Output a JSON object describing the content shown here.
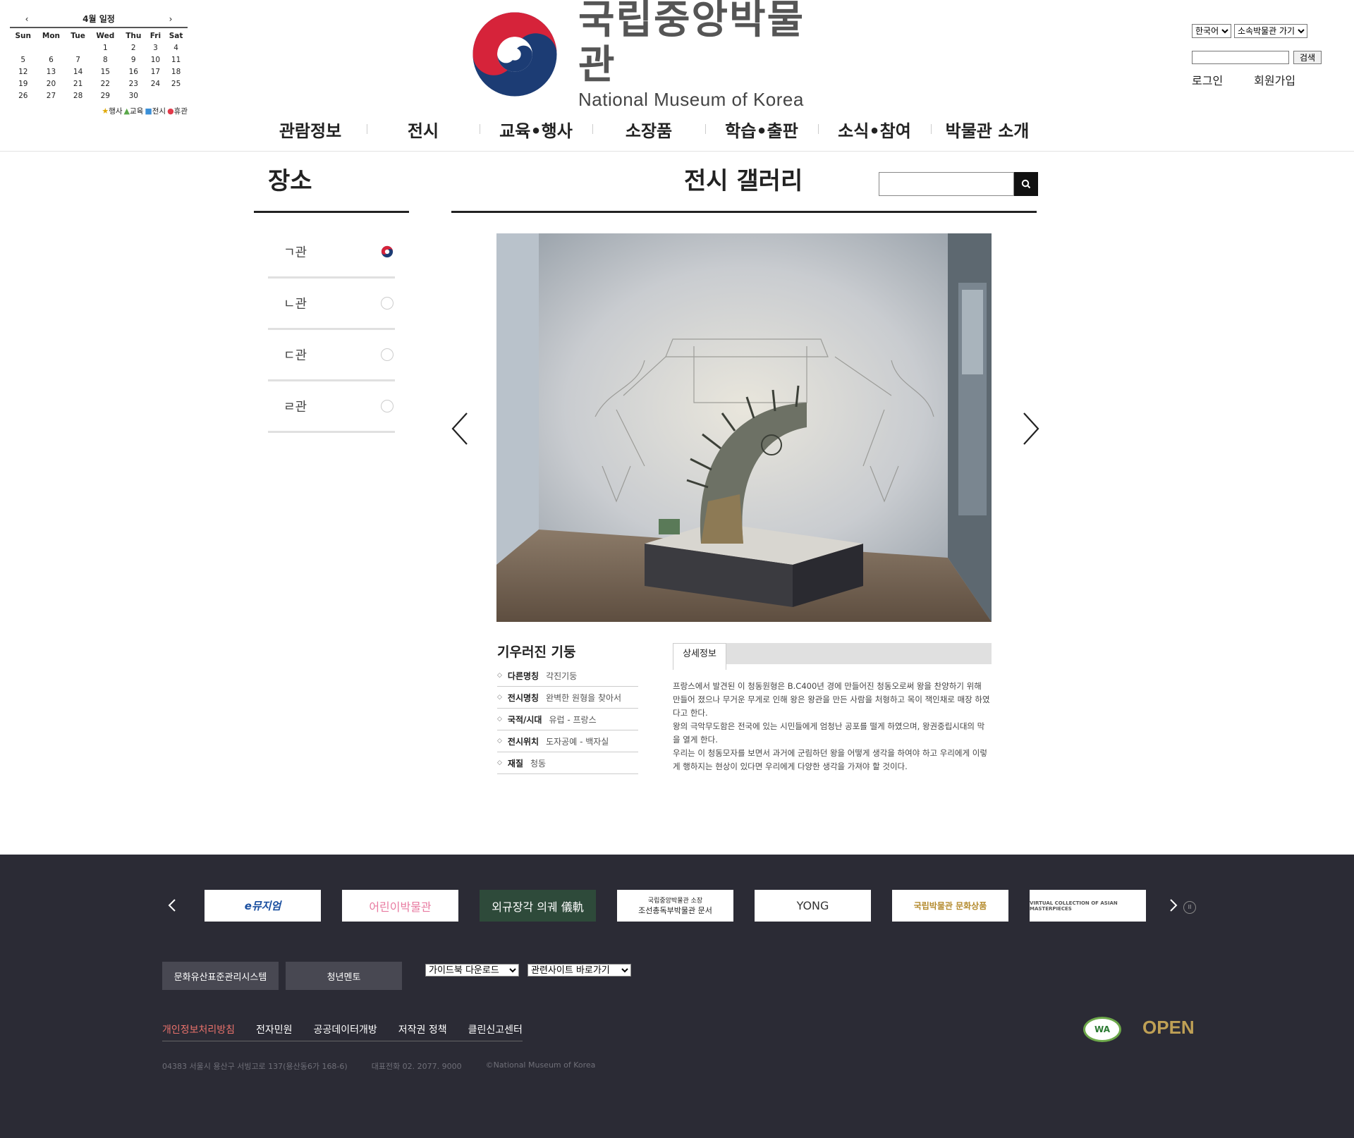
{
  "calendar": {
    "title": "4월 일정",
    "prev": "‹",
    "next": "›",
    "weekdays": [
      "Sun",
      "Mon",
      "Tue",
      "Wed",
      "Thu",
      "Fri",
      "Sat"
    ],
    "weeks": [
      [
        "",
        "",
        "",
        "1",
        "2",
        "3",
        "4"
      ],
      [
        "5",
        "6",
        "7",
        "8",
        "9",
        "10",
        "11"
      ],
      [
        "12",
        "13",
        "14",
        "15",
        "16",
        "17",
        "18"
      ],
      [
        "19",
        "20",
        "21",
        "22",
        "23",
        "24",
        "25"
      ],
      [
        "26",
        "27",
        "28",
        "29",
        "30",
        "",
        ""
      ]
    ],
    "legend": [
      {
        "symbol": "★",
        "label": "행사",
        "color": "#e0a800"
      },
      {
        "symbol": "▲",
        "label": "교육",
        "color": "#5aa84a"
      },
      {
        "symbol": "■",
        "label": "전시",
        "color": "#3a8fd8"
      },
      {
        "symbol": "●",
        "label": "휴관",
        "color": "#e23a4a"
      }
    ]
  },
  "logo": {
    "ko": "국립중앙박물관",
    "en": "National Museum of Korea"
  },
  "util": {
    "language": "한국어",
    "affiliates": "소속박물관 가기",
    "search_button": "검색",
    "login": "로그인",
    "signup": "회원가입"
  },
  "gnb": [
    "관람정보",
    "전시",
    "교육•행사",
    "소장품",
    "학습•출판",
    "소식•참여",
    "박물관 소개"
  ],
  "side": {
    "title": "장소",
    "items": [
      "ㄱ관",
      "ㄴ관",
      "ㄷ관",
      "ㄹ관"
    ],
    "selected_index": 0
  },
  "main": {
    "title": "전시 갤러리"
  },
  "artifact": {
    "title": "기우러진 기둥",
    "info": [
      {
        "key": "다른명칭",
        "value": "각진기둥"
      },
      {
        "key": "전시명칭",
        "value": "완벽한 원형을 찾아서"
      },
      {
        "key": "국적/시대",
        "value": "유럽 - 프랑스"
      },
      {
        "key": "전시위치",
        "value": "도자공예 - 백자실"
      },
      {
        "key": "재질",
        "value": "청동"
      }
    ]
  },
  "detail": {
    "tab": "상세정보",
    "text": "프랑스에서 발견된 이 청동원형은 B.C400년 경에 만들어진 청동오로써 왕을 찬양하기 위해 만들어 졌으나 무거운 무게로 인해 왕은 왕관을 만든 사람을 처형하고 목이 잭인채로 매장 하였다고 한다.\n왕의 극악무도함은 전국에 있는 시민들에게 엄청난 공포를 떨게 하였으며, 왕권중립시대의 막을 열게 한다.\n우리는 이 청동모자를 보면서 과거에 군림하던 왕을 어떻게 생각을 하여야 하고 우리에게 이렇게 행하지는 현상이 있다면 우리에게 다양한 생각을 가져야 할 것이다."
  },
  "footer": {
    "banners": [
      {
        "text": "e뮤지엄"
      },
      {
        "text": "어린이박물관"
      },
      {
        "text": "외규장각 의궤 儀軌"
      },
      {
        "text": "국립중앙박물관 소장",
        "text2": "조선총독부박물관 문서"
      },
      {
        "text": "YONG"
      },
      {
        "text": "국립박물관 문화상품"
      },
      {
        "text": "VIRTUAL COLLECTION OF ASIAN MASTERPIECES"
      }
    ],
    "buttons": [
      "문화유산표준관리시스템",
      "청년멘토"
    ],
    "selects": [
      "가이드북 다운로드",
      "관련사이트 바로가기"
    ],
    "links": [
      "개인정보처리방침",
      "전자민원",
      "공공데이터개방",
      "저작권 정책",
      "클린신고센터"
    ],
    "address": "04383 서울시 용산구 서빙고로 137(용산동6가 168-6)",
    "phone": "대표전화 02. 2077. 9000",
    "copyright": "©National Museum of Korea",
    "wa_badge": "WA",
    "open_badge": "OPEN"
  }
}
